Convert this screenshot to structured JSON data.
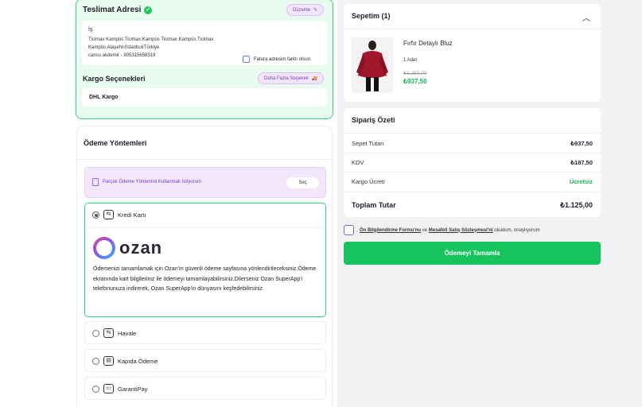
{
  "delivery": {
    "title": "Teslimat Adresi",
    "edit_label": "Düzenle",
    "address_name": "İş",
    "address_line1": "Ticimax Kampüs Ticimax Kampüs Ticimax Kampüs Ticimax",
    "address_line2": "Kampüs Ataşehir/İstanbul/Türkiye",
    "contact": "cansu akdemir - 905315658319",
    "invoice_label": "Fatura adresim farklı olsun"
  },
  "cargo": {
    "title": "Kargo Seçenekleri",
    "more_label": "Daha Fazla Seçenek",
    "selected": "DHL Kargo"
  },
  "payment": {
    "title": "Ödeme Yöntemleri",
    "partial_text": "Parçalı Ödeme Yöntemini Kullanmak İstiyorum",
    "partial_button": "Seç",
    "options": [
      {
        "label": "Kredi Kartı",
        "selected": true,
        "icon": "card-transfer-icon"
      },
      {
        "label": "Havale",
        "selected": false,
        "icon": "transfer-icon"
      },
      {
        "label": "Kapıda Ödeme",
        "selected": false,
        "icon": "cash-on-delivery-icon"
      },
      {
        "label": "GarantiPay",
        "selected": false,
        "icon": "wallet-icon"
      }
    ],
    "ozan_logo_text": "ozan",
    "ozan_description": "Ödemenizi tamamlamak için Ozan'ın güvenli ödeme sayfasına yönlendirileceksiniz.Ödeme ekranında kart bilgileriniz ile ödemeyi tamamlayabilirsiniz.Dilerseniz Ozan SuperApp'i telefonunuza indirerek, Ozan SuperApp'in dünyasını keşfedebilirsiniz."
  },
  "cart": {
    "title": "Sepetim (1)",
    "product_name": "Fırfır Detaylı Bluz",
    "quantity": "1 Adet",
    "old_price": "₺1.250,00",
    "price": "₺937,50"
  },
  "summary": {
    "title": "Sipariş Özeti",
    "rows": [
      {
        "label": "Sepet Tutarı",
        "value": "₺937,50"
      },
      {
        "label": "KDV",
        "value": "₺187,50"
      },
      {
        "label": "Kargo Ücreti",
        "value": "Ücretsiz"
      }
    ],
    "total_label": "Toplam Tutar",
    "total_value": "₺1.125,00"
  },
  "agreement": {
    "link1": "Ön Bilgilendirme Formu'nu",
    "middle": "ve",
    "link2": "Mesafeli Satış Sözleşmesi'ni",
    "suffix": "okudum, onaylıyorum"
  },
  "complete_button": "Ödemeyi Tamamla",
  "colors": {
    "accent_green": "#16c45e",
    "accent_purple": "#7c3fbf",
    "border_green": "#35d07f"
  }
}
